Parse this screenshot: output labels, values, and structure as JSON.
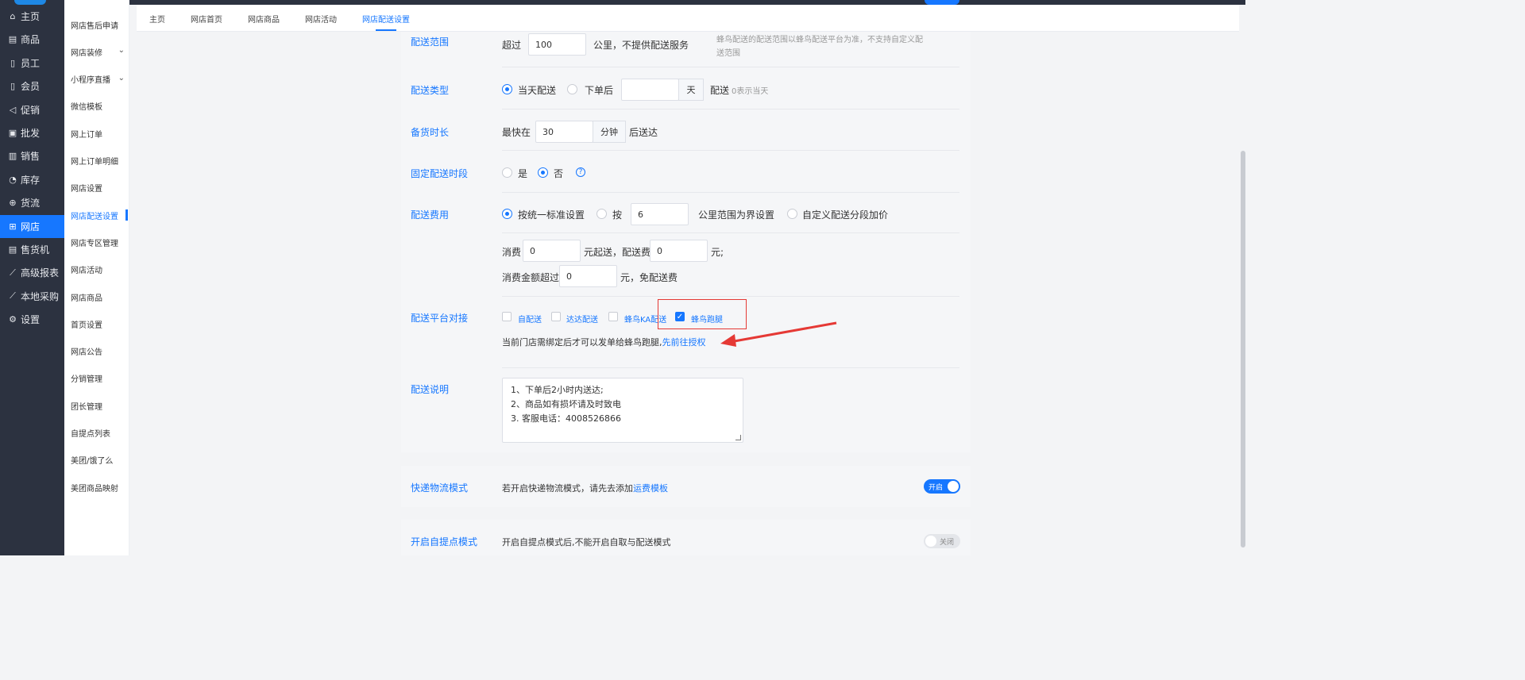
{
  "sidebar": {
    "items": [
      {
        "icon": "home-icon",
        "glyph": "⌂",
        "label": "主页"
      },
      {
        "icon": "goods-icon",
        "glyph": "▤",
        "label": "商品"
      },
      {
        "icon": "staff-icon",
        "glyph": "▯",
        "label": "员工"
      },
      {
        "icon": "member-icon",
        "glyph": "▯",
        "label": "会员"
      },
      {
        "icon": "promo-icon",
        "glyph": "◁",
        "label": "促销"
      },
      {
        "icon": "wholesale-icon",
        "glyph": "▣",
        "label": "批发"
      },
      {
        "icon": "sales-icon",
        "glyph": "▥",
        "label": "销售"
      },
      {
        "icon": "stock-icon",
        "glyph": "◔",
        "label": "库存"
      },
      {
        "icon": "flow-icon",
        "glyph": "⊕",
        "label": "货流"
      },
      {
        "icon": "eshop-icon",
        "glyph": "⊞",
        "label": "网店"
      },
      {
        "icon": "vending-icon",
        "glyph": "▤",
        "label": "售货机"
      },
      {
        "icon": "report-icon",
        "glyph": "⟋",
        "label": "高级报表"
      },
      {
        "icon": "purchase-icon",
        "glyph": "⟋",
        "label": "本地采购"
      },
      {
        "icon": "settings-icon",
        "glyph": "⚙",
        "label": "设置"
      }
    ],
    "active_index": 9
  },
  "submenu": {
    "items": [
      {
        "label": "网店售后申请",
        "chev": ""
      },
      {
        "label": "网店装修",
        "chev": "⌄"
      },
      {
        "label": "小程序直播",
        "chev": "⌄"
      },
      {
        "label": "微信模板",
        "chev": ""
      },
      {
        "label": "网上订单",
        "chev": ""
      },
      {
        "label": "网上订单明细",
        "chev": ""
      },
      {
        "label": "网店设置",
        "chev": ""
      },
      {
        "label": "网店配送设置",
        "chev": ""
      },
      {
        "label": "网店专区管理",
        "chev": ""
      },
      {
        "label": "网店活动",
        "chev": ""
      },
      {
        "label": "网店商品",
        "chev": ""
      },
      {
        "label": "首页设置",
        "chev": ""
      },
      {
        "label": "网店公告",
        "chev": ""
      },
      {
        "label": "分销管理",
        "chev": ""
      },
      {
        "label": "团长管理",
        "chev": ""
      },
      {
        "label": "自提点列表",
        "chev": ""
      },
      {
        "label": "美团/饿了么",
        "chev": ""
      },
      {
        "label": "美团商品映射",
        "chev": ""
      }
    ],
    "active_index": 7
  },
  "tabs": [
    "主页",
    "网店首页",
    "网店商品",
    "网店活动",
    "网店配送设置"
  ],
  "tabs_active_index": 4,
  "form": {
    "range": {
      "label": "配送范围",
      "prefix": "超过",
      "value": "100",
      "suffix": "公里，不提供配送服务",
      "note_line1": "蜂鸟配送的配送范围以蜂鸟配送平台为准，不支持自定义配",
      "note_line2": "送范围"
    },
    "type": {
      "label": "配送类型",
      "opt1": "当天配送",
      "opt2": "下单后",
      "days_value": "",
      "days_unit": "天",
      "after": "配送",
      "hint": "0表示当天"
    },
    "prep": {
      "label": "备货时长",
      "prefix": "最快在",
      "value": "30",
      "unit": "分钟",
      "suffix": "后送达"
    },
    "fixed": {
      "label": "固定配送时段",
      "yes": "是",
      "no": "否",
      "help": "?"
    },
    "fee": {
      "label": "配送费用",
      "opt1": "按统一标准设置",
      "opt2": "按",
      "km_value": "6",
      "opt2_suffix": "公里范围为界设置",
      "opt3": "自定义配送分段加价",
      "consume_prefix": "消费",
      "consume_value": "0",
      "start_text": "元起送，配送费",
      "fee_value": "0",
      "yuan": "元;",
      "free_prefix": "消费金额超过",
      "free_value": "0",
      "free_suffix": "元，免配送费"
    },
    "platform": {
      "label": "配送平台对接",
      "options": [
        {
          "label": "自配送",
          "checked": false
        },
        {
          "label": "达达配送",
          "checked": false
        },
        {
          "label": "蜂鸟KA配送",
          "checked": false
        },
        {
          "label": "蜂鸟跑腿",
          "checked": true
        }
      ],
      "notice": "当前门店需绑定后才可以发单给蜂鸟跑腿,",
      "auth_link": "先前往授权"
    },
    "desc": {
      "label": "配送说明",
      "line1": "1、下单后2小时内送达;",
      "line2": "2、商品如有损坏请及时致电",
      "line3": "3.  客服电话：4008526866"
    }
  },
  "express": {
    "label": "快递物流模式",
    "text": "若开启快递物流模式，请先去添加",
    "link": "运费模板",
    "switch_label": "开启",
    "switch_on": true
  },
  "pickup": {
    "label": "开启自提点模式",
    "text": "开启自提点模式后,不能开启自取与配送模式",
    "switch_label": "关闭",
    "switch_on": false
  },
  "colors": {
    "accent": "#1677ff",
    "sidebar": "#2c3240",
    "annotation": "#e53935"
  }
}
